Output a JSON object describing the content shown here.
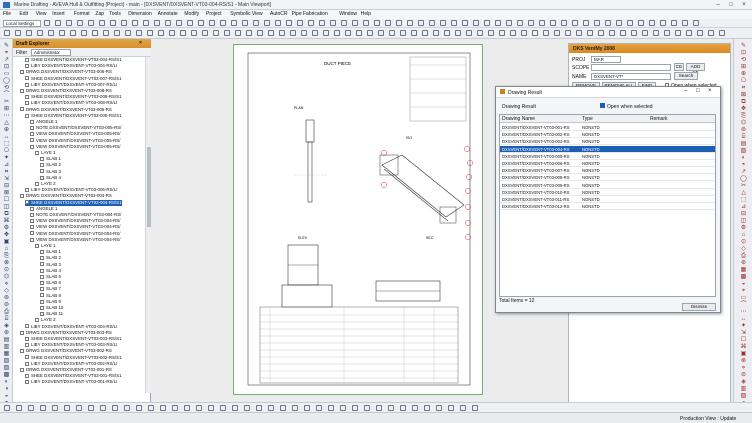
{
  "window": {
    "title": "Marine Drafting - AVEVA Hull & Outfitting (Project) - main - [DXSVENT/DXSVENT-VT03-004-RS/S1 - Main Viewport]"
  },
  "menu": [
    "File",
    "Edit",
    "View",
    "Insert",
    "Format",
    "Zap",
    "Tools",
    "Dimension",
    "Annotate",
    "Modify",
    "Project",
    "Symbolic View",
    "AutoCR",
    "Pipe Fabrication",
    "Window",
    "Help"
  ],
  "toolbar": {
    "layer_combo": "Local Settings"
  },
  "explorer": {
    "title": "Draft Explorer",
    "filter_label": "Filter",
    "filter_value": "Administrator",
    "items": [
      {
        "t": "SHEE DXSVENT/DXSVENT-VT03-004-RS/S1",
        "i": 2
      },
      {
        "t": "LIBY DXSVENT/DXSVENT-VT03-004-RS/LI",
        "i": 2
      },
      {
        "t": "DRWG DXSVENT/DXSVENT-VT03-006-RS",
        "i": 1
      },
      {
        "t": "SHEE DXSVENT/DXSVENT-VT03-007-RS/S1",
        "i": 2
      },
      {
        "t": "LIBY DXSVENT/DXSVENT-VT03-007-RS/LI",
        "i": 2
      },
      {
        "t": "DRWG DXSVENT/DXSVENT-VT03-008-RS",
        "i": 1
      },
      {
        "t": "SHEE DXSVENT/DXSVENT-VT03-008-RS/S1",
        "i": 2
      },
      {
        "t": "LIBY DXSVENT/DXSVENT-VT03-008-RS/LI",
        "i": 2
      },
      {
        "t": "DRWG DXSVENT/DXSVENT-VT03-005-RS",
        "i": 1
      },
      {
        "t": "SHEE DXSVENT/DXSVENT-VT03-005-RS/S1",
        "i": 2
      },
      {
        "t": "ANGELE 1",
        "i": 3
      },
      {
        "t": "NOTE DXSVENT/DXSVENT-VT03-005-RS/",
        "i": 3
      },
      {
        "t": "VIEW DXSVENT/DXSVENT-VT03-005-RS/",
        "i": 3
      },
      {
        "t": "VIEW DXSVENT/DXSVENT-VT03-005-RS/",
        "i": 3
      },
      {
        "t": "VIEW DXSVENT/DXSVENT-VT03-005-RS/",
        "i": 3
      },
      {
        "t": "LAYE 1",
        "i": 4
      },
      {
        "t": "SLAB 1",
        "i": 5
      },
      {
        "t": "SLAB 2",
        "i": 5
      },
      {
        "t": "SLAB 3",
        "i": 5
      },
      {
        "t": "SLAB 4",
        "i": 5
      },
      {
        "t": "LAYE 2",
        "i": 4
      },
      {
        "t": "LIBY DXSVENT/DXSVENT-VT03-005-RS/LI",
        "i": 2
      },
      {
        "t": "DRWG DXSVENT/DXSVENT-VT03-004-RS",
        "i": 1
      },
      {
        "t": "SHEE DXSVENT/DXSVENT-VT03-004-RS/S1",
        "i": 2,
        "sel": true
      },
      {
        "t": "ANGELE 1",
        "i": 3
      },
      {
        "t": "NOTE DXSVENT/DXSVENT-VT03-004-RS/",
        "i": 3
      },
      {
        "t": "VIEW DXSVENT/DXSVENT-VT03-004-RS/",
        "i": 3
      },
      {
        "t": "VIEW DXSVENT/DXSVENT-VT03-004-RS/",
        "i": 3
      },
      {
        "t": "VIEW DXSVENT/DXSVENT-VT03-004-RS/",
        "i": 3
      },
      {
        "t": "VIEW DXSVENT/DXSVENT-VT03-004-RS/",
        "i": 3
      },
      {
        "t": "LAYE 1",
        "i": 4
      },
      {
        "t": "SLAB 1",
        "i": 5
      },
      {
        "t": "SLAB 2",
        "i": 5
      },
      {
        "t": "SLAB 3",
        "i": 5
      },
      {
        "t": "SLAB 4",
        "i": 5
      },
      {
        "t": "SLAB 5",
        "i": 5
      },
      {
        "t": "SLAB 6",
        "i": 5
      },
      {
        "t": "SLAB 7",
        "i": 5
      },
      {
        "t": "SLAB 8",
        "i": 5
      },
      {
        "t": "SLAB 9",
        "i": 5
      },
      {
        "t": "SLAB 10",
        "i": 5
      },
      {
        "t": "SLAB 11",
        "i": 5
      },
      {
        "t": "LAYE 2",
        "i": 4
      },
      {
        "t": "LIBY DXSVENT/DXSVENT-VT03-004-RS/LI",
        "i": 2
      },
      {
        "t": "DRWG DXSVENT/DXSVENT-VT03-003-RS",
        "i": 1
      },
      {
        "t": "SHEE DXSVENT/DXSVENT-VT03-003-RS/S1",
        "i": 2
      },
      {
        "t": "LIBY DXSVENT/DXSVENT-VT03-003-RS/LI",
        "i": 2
      },
      {
        "t": "DRWG DXSVENT/DXSVENT-VT03-002-RS",
        "i": 1
      },
      {
        "t": "SHEE DXSVENT/DXSVENT-VT03-002-RS/S1",
        "i": 2
      },
      {
        "t": "LIBY DXSVENT/DXSVENT-VT03-002-RS/LI",
        "i": 2
      },
      {
        "t": "DRWG DXSVENT/DXSVENT-VT03-001-RS",
        "i": 1
      },
      {
        "t": "SHEE DXSVENT/DXSVENT-VT03-001-RS/S1",
        "i": 2
      },
      {
        "t": "LIBY DXSVENT/DXSVENT-VT03-001-RS/LI",
        "i": 2
      }
    ]
  },
  "sheet": {
    "title": "DUCT PIECE",
    "view_plan": "PLAN",
    "view_iso": "ISO",
    "view_elev": "ELEV",
    "view_sec": "SEC"
  },
  "panel": {
    "title": "DKS VentMy 2008",
    "proj_label": "PROJ",
    "proj_value": "MAR",
    "scope_label": "SCOPE",
    "name_label": "NAME",
    "name_value": "DXSVENT-VT*",
    "ce_btn": "CE",
    "add_ce_btn": "ADD CE",
    "search_btn": "Search",
    "remove_btn": "REMOVE",
    "remove_all_btn": "REMOVE ALL",
    "find_btn": "FIND",
    "open_selected": "Open when selected"
  },
  "dialog": {
    "title": "Drawing Result",
    "header_label": "Drawing Result",
    "open_checkbox": "Open when selected",
    "columns": [
      "Drawing Name",
      "Type",
      "Remark"
    ],
    "rows": [
      {
        "name": "DXSVENT/DXSVENT-VT03-001-RS",
        "type": "NONSTD"
      },
      {
        "name": "DXSVENT/DXSVENT-VT03-002-RS",
        "type": "NONSTD"
      },
      {
        "name": "DXSVENT/DXSVENT-VT03-003-RS",
        "type": "NONSTD"
      },
      {
        "name": "DXSVENT/DXSVENT-VT03-004-RS",
        "type": "NONSTD",
        "sel": true
      },
      {
        "name": "DXSVENT/DXSVENT-VT03-005-RS",
        "type": "NONSTD"
      },
      {
        "name": "DXSVENT/DXSVENT-VT03-006-RS",
        "type": "NONSTD"
      },
      {
        "name": "DXSVENT/DXSVENT-VT03-007-RS",
        "type": "NONSTD"
      },
      {
        "name": "DXSVENT/DXSVENT-VT03-008-RS",
        "type": "NONSTD"
      },
      {
        "name": "DXSVENT/DXSVENT-VT03-009-RS",
        "type": "NONSTD"
      },
      {
        "name": "DXSVENT/DXSVENT-VT03-010-RS",
        "type": "NONSTD"
      },
      {
        "name": "DXSVENT/DXSVENT-VT03-011-RS",
        "type": "NONSTD"
      },
      {
        "name": "DXSVENT/DXSVENT-VT03-012-RS",
        "type": "NONSTD"
      }
    ],
    "total": "Total Items = 12",
    "dismiss": "Dismiss"
  },
  "status": {
    "right": "Production View : Update"
  }
}
